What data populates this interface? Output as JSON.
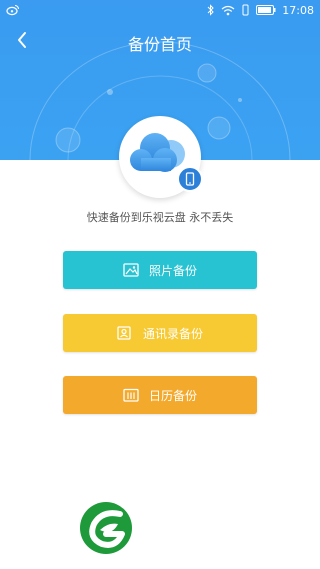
{
  "status_bar": {
    "time": "17:08",
    "icons": [
      "weibo-icon",
      "bluetooth-icon",
      "wifi-icon",
      "phone-vibrate-icon",
      "battery-icon"
    ]
  },
  "header": {
    "title": "备份首页",
    "back_icon": "chevron-left-icon",
    "background_color": "#3a9bf0"
  },
  "hero": {
    "icon": "cloud-icon",
    "badge_icon": "phone-icon"
  },
  "slogan": "快速备份到乐视云盘 永不丢失",
  "actions": [
    {
      "label": "照片备份",
      "icon": "image-icon",
      "color": "#27c3d3"
    },
    {
      "label": "通讯录备份",
      "icon": "contact-card-icon",
      "color": "#f7c932"
    },
    {
      "label": "日历备份",
      "icon": "calendar-icon",
      "color": "#f3a92c"
    }
  ],
  "watermark": {
    "icon": "leaf-logo-icon",
    "color": "#1e9a3a"
  }
}
